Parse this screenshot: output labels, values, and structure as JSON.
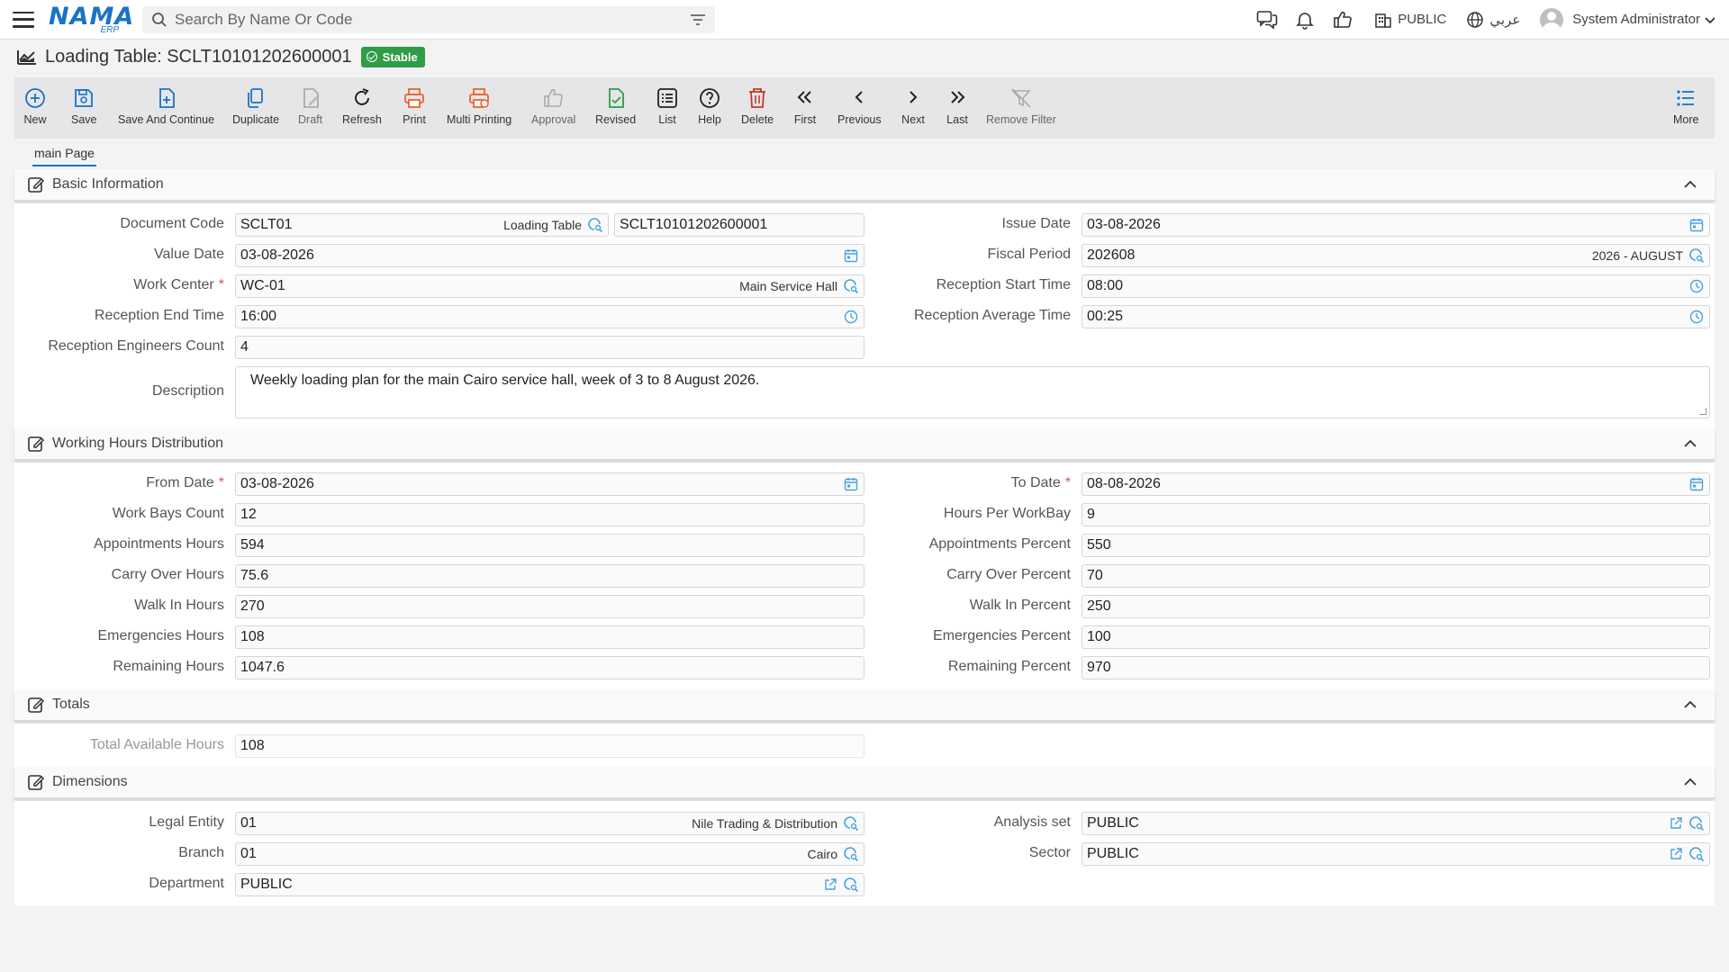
{
  "app": {
    "logo": "NAMA",
    "logo_sub": "ERP"
  },
  "search": {
    "placeholder": "Search By Name Or Code"
  },
  "header": {
    "branch": "PUBLIC",
    "language": "عربي",
    "user": "System Administrator"
  },
  "page": {
    "title": "Loading Table: SCLT10101202600001",
    "status": "Stable",
    "status_color": "#2f9c47"
  },
  "toolbar": {
    "new": "New",
    "save": "Save",
    "save_continue": "Save And Continue",
    "duplicate": "Duplicate",
    "draft": "Draft",
    "refresh": "Refresh",
    "print": "Print",
    "multi_printing": "Multi Printing",
    "approval": "Approval",
    "revised": "Revised",
    "list": "List",
    "help": "Help",
    "delete": "Delete",
    "first": "First",
    "previous": "Previous",
    "next": "Next",
    "last": "Last",
    "remove_filter": "Remove Filter",
    "more": "More"
  },
  "tabs": {
    "main": "main Page"
  },
  "basic": {
    "title": "Basic Information",
    "document_code_label": "Document Code",
    "document_code": "SCLT01",
    "document_code_ref": "Loading Table",
    "document_number": "SCLT10101202600001",
    "issue_date_label": "Issue Date",
    "issue_date": "03-08-2026",
    "value_date_label": "Value Date",
    "value_date": "03-08-2026",
    "fiscal_period_label": "Fiscal Period",
    "fiscal_period": "202608",
    "fiscal_period_ref": "2026 - AUGUST",
    "work_center_label": "Work Center",
    "work_center": "WC-01",
    "work_center_ref": "Main Service Hall",
    "reception_start_label": "Reception Start Time",
    "reception_start": "08:00",
    "reception_end_label": "Reception End Time",
    "reception_end": "16:00",
    "reception_avg_label": "Reception Average Time",
    "reception_avg": "00:25",
    "engineers_label": "Reception Engineers Count",
    "engineers": "4",
    "description_label": "Description",
    "description": "Weekly loading plan for the main Cairo service hall, week of 3 to 8 August 2026."
  },
  "hours": {
    "title": "Working Hours Distribution",
    "from_date_label": "From Date",
    "from_date": "03-08-2026",
    "to_date_label": "To Date",
    "to_date": "08-08-2026",
    "work_bays_label": "Work Bays Count",
    "work_bays": "12",
    "hours_per_bay_label": "Hours Per WorkBay",
    "hours_per_bay": "9",
    "appointments_hours_label": "Appointments Hours",
    "appointments_hours": "594",
    "appointments_percent_label": "Appointments Percent",
    "appointments_percent": "550",
    "carry_hours_label": "Carry Over Hours",
    "carry_hours": "75.6",
    "carry_percent_label": "Carry Over Percent",
    "carry_percent": "70",
    "walkin_hours_label": "Walk In Hours",
    "walkin_hours": "270",
    "walkin_percent_label": "Walk In Percent",
    "walkin_percent": "250",
    "emerg_hours_label": "Emergencies Hours",
    "emerg_hours": "108",
    "emerg_percent_label": "Emergencies Percent",
    "emerg_percent": "100",
    "remaining_hours_label": "Remaining Hours",
    "remaining_hours": "1047.6",
    "remaining_percent_label": "Remaining Percent",
    "remaining_percent": "970"
  },
  "totals": {
    "title": "Totals",
    "available_label": "Total Available Hours",
    "available": "108"
  },
  "dimensions": {
    "title": "Dimensions",
    "legal_entity_label": "Legal Entity",
    "legal_entity": "01",
    "legal_entity_ref": "Nile Trading & Distribution",
    "analysis_set_label": "Analysis set",
    "analysis_set": "PUBLIC",
    "branch_label": "Branch",
    "branch": "01",
    "branch_ref": "Cairo",
    "sector_label": "Sector",
    "sector": "PUBLIC",
    "department_label": "Department",
    "department": "PUBLIC"
  },
  "icons": {
    "menu": "hamburger-icon",
    "search": "search-icon",
    "filter": "filter-icon",
    "chat": "chat-icon",
    "bell": "bell-icon",
    "like": "thumbs-up-icon",
    "building": "building-icon",
    "globe": "globe-icon",
    "calendar": "calendar-icon",
    "clock": "clock-icon",
    "lookup": "lookup-search-icon",
    "link": "external-link-icon"
  },
  "colors": {
    "accent": "#1a73c7",
    "lookup": "#4aa3df",
    "print": "#e8642c",
    "delete": "#c0392b",
    "revised": "#2f9c47",
    "toolbar_bg": "#e6e6e8"
  }
}
